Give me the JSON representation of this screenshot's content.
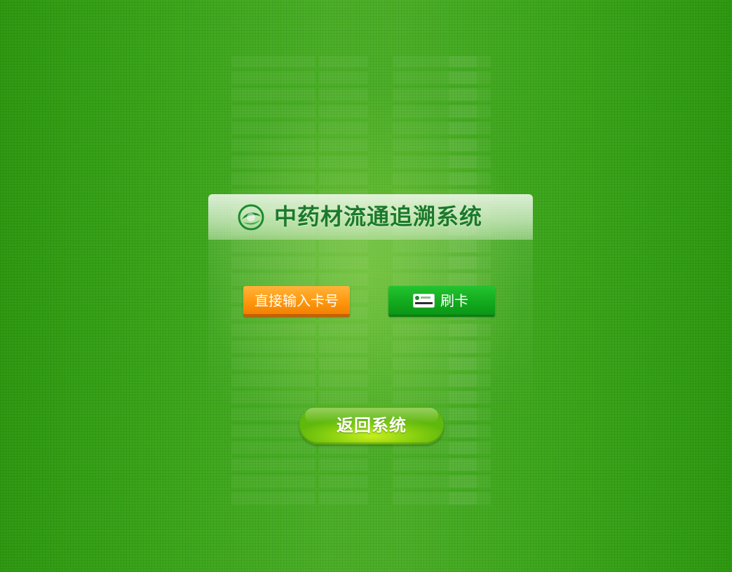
{
  "header": {
    "title": "中药材流通追溯系统",
    "logo_icon": "leaf-globe-logo-icon"
  },
  "actions": {
    "manual_entry_label": "直接输入卡号",
    "swipe_card_label": "刷卡",
    "swipe_card_icon": "card-icon",
    "return_label": "返回系统"
  },
  "colors": {
    "background": "#3aa61a",
    "title": "#1b7a2a",
    "manual_button": "#ff9a12",
    "swipe_button": "#13aa1e",
    "return_button": "#94d612"
  }
}
